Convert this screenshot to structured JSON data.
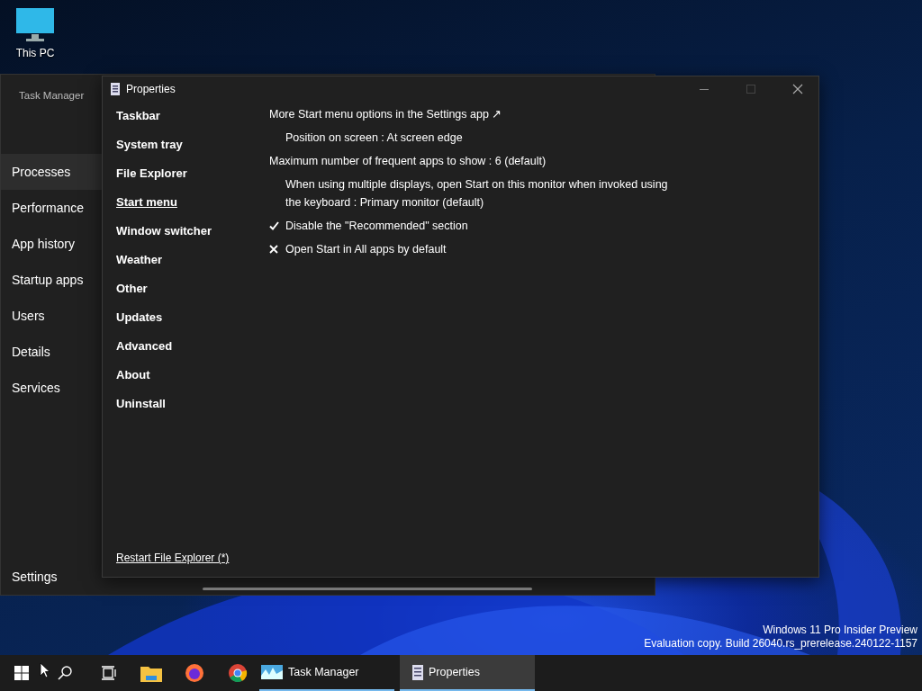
{
  "desktop_icons": [
    {
      "label": "This PC"
    }
  ],
  "task_manager": {
    "title": "Task Manager",
    "nav": [
      {
        "label": "Processes",
        "selected": true
      },
      {
        "label": "Performance",
        "selected": false
      },
      {
        "label": "App history",
        "selected": false
      },
      {
        "label": "Startup apps",
        "selected": false
      },
      {
        "label": "Users",
        "selected": false
      },
      {
        "label": "Details",
        "selected": false
      },
      {
        "label": "Services",
        "selected": false
      }
    ],
    "settings": "Settings"
  },
  "properties": {
    "title": "Properties",
    "sidebar": [
      {
        "label": "Taskbar",
        "selected": false
      },
      {
        "label": "System tray",
        "selected": false
      },
      {
        "label": "File Explorer",
        "selected": false
      },
      {
        "label": "Start menu",
        "selected": true
      },
      {
        "label": "Window switcher",
        "selected": false
      },
      {
        "label": "Weather",
        "selected": false
      },
      {
        "label": "Other",
        "selected": false
      },
      {
        "label": "Updates",
        "selected": false
      },
      {
        "label": "Advanced",
        "selected": false
      },
      {
        "label": "About",
        "selected": false
      },
      {
        "label": "Uninstall",
        "selected": false
      }
    ],
    "options": [
      {
        "kind": "link",
        "text": "More Start menu options in the Settings app ↗"
      },
      {
        "kind": "choice",
        "text": "Position on screen : At screen edge"
      },
      {
        "kind": "number",
        "text": "Maximum number of frequent apps to show : 6 (default)"
      },
      {
        "kind": "choice",
        "text": "When using multiple displays, open Start on this monitor when invoked using the keyboard : Primary monitor (default)"
      },
      {
        "kind": "toggle",
        "text": "Disable the \"Recommended\" section",
        "checked": true
      },
      {
        "kind": "toggle",
        "text": "Open Start in All apps by default",
        "checked": false
      }
    ],
    "footer_link": "Restart File Explorer (*)"
  },
  "evaluation_notice": [
    "Windows 11 Pro Insider Preview",
    "Evaluation copy. Build 26040.rs_prerelease.240122-1157"
  ],
  "taskbar": {
    "apps": [
      {
        "label": "Task Manager",
        "selected": false
      },
      {
        "label": "Properties",
        "selected": true
      }
    ]
  }
}
